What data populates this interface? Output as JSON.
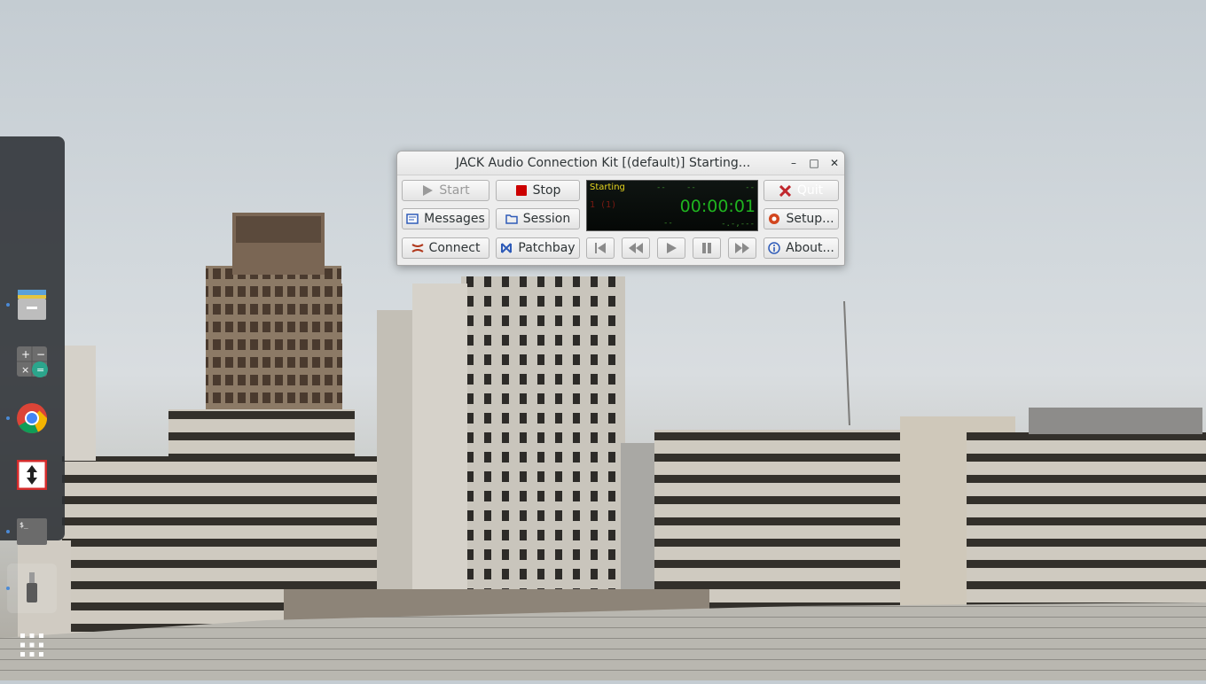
{
  "window": {
    "title": "JACK Audio Connection Kit [(default)] Starting...",
    "minimize_label": "–",
    "maximize_label": "□",
    "close_label": "✕"
  },
  "buttons": {
    "start": "Start",
    "stop": "Stop",
    "quit": "Quit",
    "messages": "Messages",
    "session": "Session",
    "setup": "Setup...",
    "connect": "Connect",
    "patchbay": "Patchbay",
    "about": "About..."
  },
  "display": {
    "status": "Starting",
    "dash_a": "--",
    "dash_b": "--",
    "dash_c": "--",
    "xruns": "1 (1)",
    "time": "00:00:01",
    "dash_d": "--",
    "rate": "-.-,---"
  },
  "transport": [
    "rewind-to-start",
    "backward",
    "play",
    "pause",
    "forward"
  ],
  "dock": {
    "items": [
      "files",
      "calculator",
      "chrome",
      "transfer-app",
      "terminal",
      "usb-device",
      "app-grid"
    ],
    "running_dot_color": "#4b8ad6"
  },
  "colors": {
    "accent_stop": "#cc0000",
    "quit_icon": "#c0272d",
    "time_text": "#1fb41f",
    "status_text": "#e6d51f"
  }
}
